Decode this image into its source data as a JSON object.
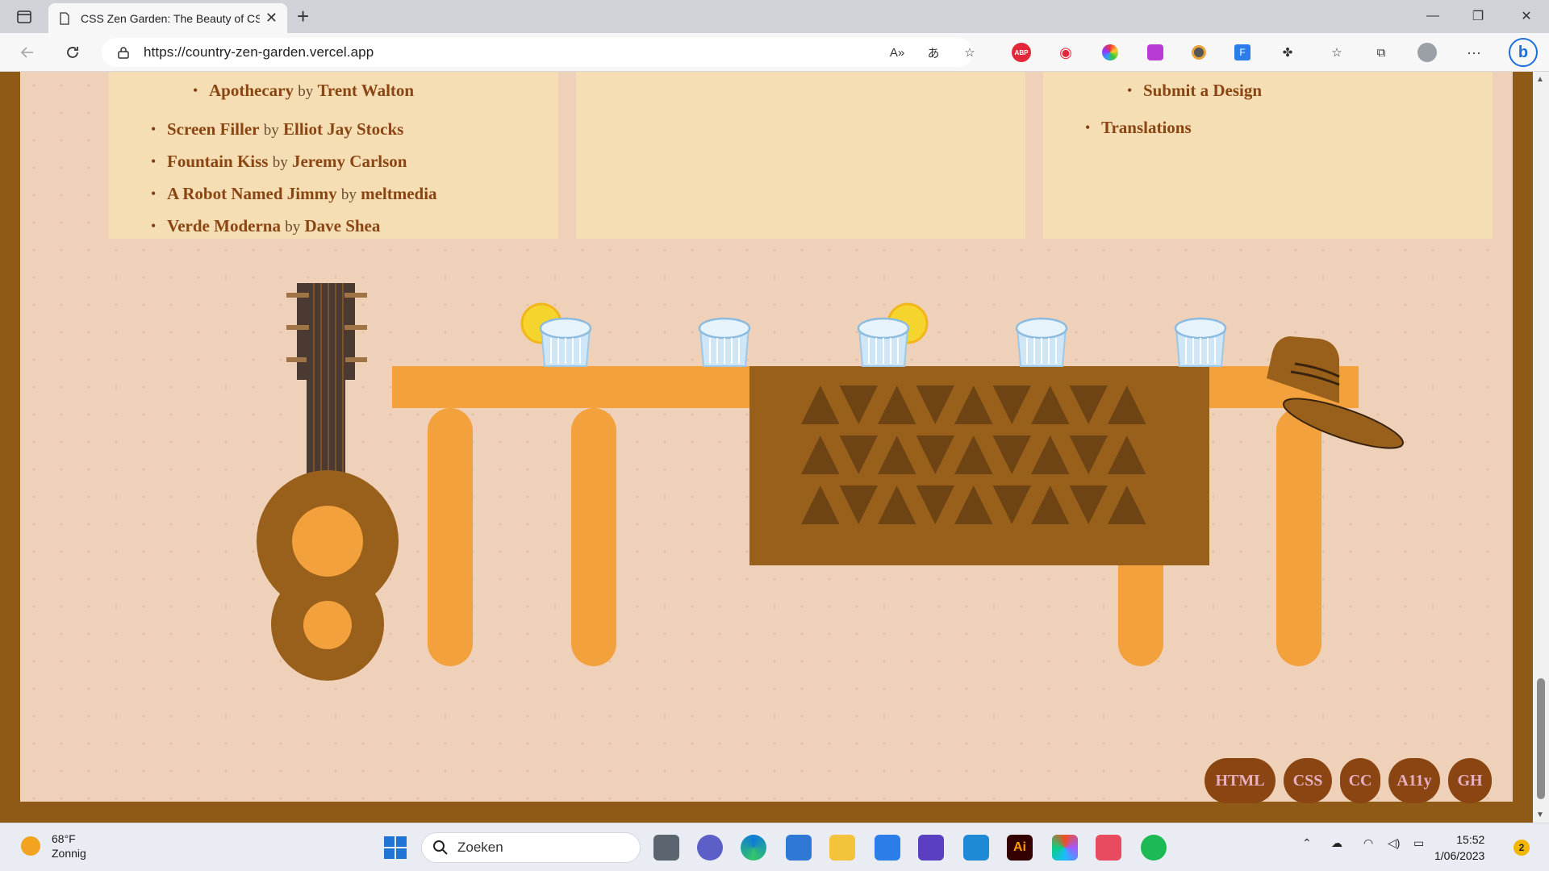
{
  "browser": {
    "tab_title": "CSS Zen Garden: The Beauty of CSS Design",
    "url": "https://country-zen-garden.vercel.app",
    "window_controls": [
      "minimize",
      "restore",
      "close"
    ],
    "toolbar_icons": [
      "read-aloud-icon",
      "translate-icon",
      "add-favorite-icon",
      "adblock-icon",
      "record-icon",
      "color-picker-icon",
      "extension-icon",
      "profile-ext-icon",
      "ext-f-icon",
      "extensions-icon",
      "favorites-icon",
      "collections-icon",
      "profile-icon",
      "more-icon",
      "bing-icon"
    ],
    "adblock_label": "ABP"
  },
  "page": {
    "left_list": {
      "partial_item": {
        "title": "Apothecary",
        "by": "by",
        "author": "Trent Walton"
      },
      "items": [
        {
          "title": "Screen Filler",
          "by": "by",
          "author": "Elliot Jay Stocks"
        },
        {
          "title": "Fountain Kiss",
          "by": "by",
          "author": "Jeremy Carlson"
        },
        {
          "title": "A Robot Named Jimmy",
          "by": "by",
          "author": "meltmedia"
        },
        {
          "title": "Verde Moderna",
          "by": "by",
          "author": "Dave Shea"
        }
      ]
    },
    "right_list": {
      "partial_item": "Submit a Design",
      "items": [
        "Translations"
      ]
    },
    "illustration": {
      "glasses": 5,
      "lemons_on_glasses": [
        1,
        3
      ]
    },
    "footer_badges": [
      "HTML",
      "CSS",
      "CC",
      "A11y",
      "GH"
    ],
    "colors": {
      "frame": "#8e5a15",
      "background": "#efd0b8",
      "card": "#f5deb3",
      "link": "#8a4513",
      "table": "#f2a13c",
      "runner": "#98601a"
    }
  },
  "taskbar": {
    "weather_temp": "68°F",
    "weather_desc": "Zonnig",
    "search_placeholder": "Zoeken",
    "time": "15:52",
    "date": "1/06/2023",
    "notification_count": "2"
  }
}
